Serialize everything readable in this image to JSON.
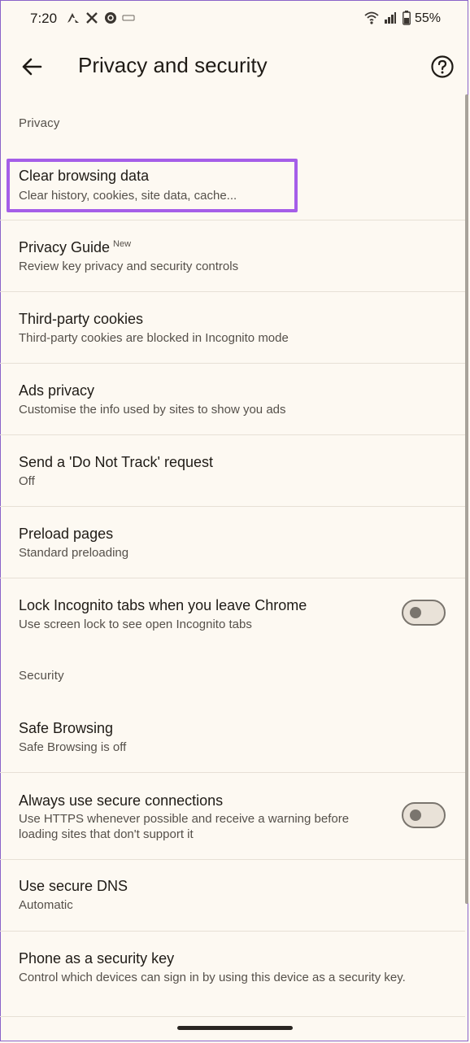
{
  "status_bar": {
    "time": "7:20",
    "battery": "55%",
    "icons": [
      "app-a-icon",
      "x-icon",
      "threads-icon",
      "camera-icon",
      "wifi-icon",
      "signal-icon",
      "battery-icon"
    ]
  },
  "app_bar": {
    "title": "Privacy and security",
    "back_icon": "arrow-back-icon",
    "help_icon": "help-circle-icon"
  },
  "sections": {
    "privacy": "Privacy",
    "security": "Security"
  },
  "items": {
    "clear_browsing": {
      "title": "Clear browsing data",
      "subtitle": "Clear history, cookies, site data, cache..."
    },
    "privacy_guide": {
      "title": "Privacy Guide",
      "badge": "New",
      "subtitle": "Review key privacy and security controls"
    },
    "third_party": {
      "title": "Third-party cookies",
      "subtitle": "Third-party cookies are blocked in Incognito mode"
    },
    "ads_privacy": {
      "title": "Ads privacy",
      "subtitle": "Customise the info used by sites to show you ads"
    },
    "do_not_track": {
      "title": "Send a 'Do Not Track' request",
      "subtitle": "Off"
    },
    "preload": {
      "title": "Preload pages",
      "subtitle": "Standard preloading"
    },
    "lock_incognito": {
      "title": "Lock Incognito tabs when you leave Chrome",
      "subtitle": "Use screen lock to see open Incognito tabs",
      "toggle_on": false
    },
    "safe_browsing": {
      "title": "Safe Browsing",
      "subtitle": "Safe Browsing is off"
    },
    "secure_connections": {
      "title": "Always use secure connections",
      "subtitle_line1": "Use HTTPS whenever possible and receive a warning before",
      "subtitle_line2": "loading sites that don't support it",
      "toggle_on": false
    },
    "secure_dns": {
      "title": "Use secure DNS",
      "subtitle": "Automatic"
    },
    "security_key": {
      "title": "Phone as a security key",
      "subtitle": "Control which devices can sign in by using this device as a security key."
    }
  },
  "colors": {
    "background": "#fdf9f2",
    "highlight": "#a55ee8",
    "text_primary": "#1f1b16",
    "text_secondary": "#55504a"
  }
}
